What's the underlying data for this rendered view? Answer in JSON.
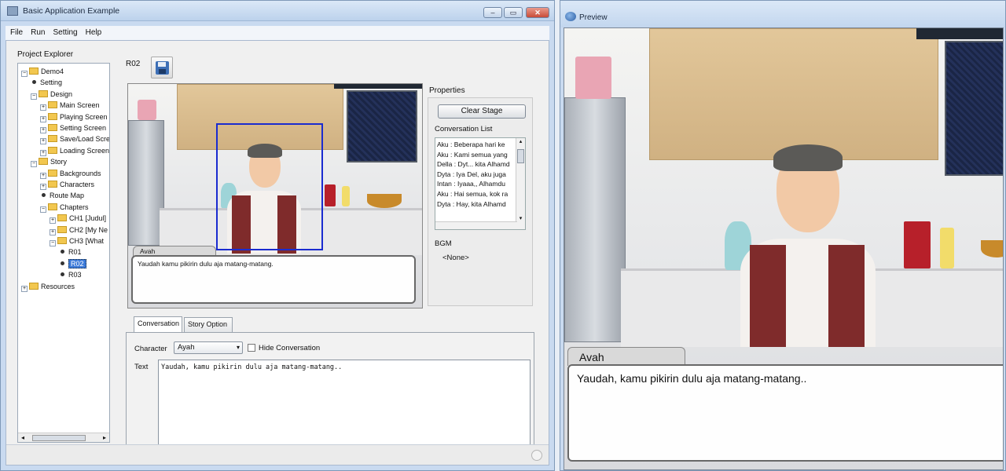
{
  "main_window": {
    "title": "Basic Application Example",
    "controls": {
      "minimize": "‒",
      "maximize": "▭",
      "close": "✕"
    },
    "menu": [
      "File",
      "Run",
      "Setting",
      "Help"
    ]
  },
  "explorer": {
    "label": "Project Explorer",
    "tree": [
      {
        "depth": 0,
        "type": "folder",
        "expander": "−",
        "label": "Demo4"
      },
      {
        "depth": 1,
        "type": "leaf",
        "label": "Setting"
      },
      {
        "depth": 1,
        "type": "folder",
        "expander": "−",
        "label": "Design"
      },
      {
        "depth": 2,
        "type": "folder",
        "expander": "+",
        "label": "Main Screen"
      },
      {
        "depth": 2,
        "type": "folder",
        "expander": "+",
        "label": "Playing Screen"
      },
      {
        "depth": 2,
        "type": "folder",
        "expander": "+",
        "label": "Setting Screen"
      },
      {
        "depth": 2,
        "type": "folder",
        "expander": "+",
        "label": "Save/Load Scre"
      },
      {
        "depth": 2,
        "type": "folder",
        "expander": "+",
        "label": "Loading Screen"
      },
      {
        "depth": 1,
        "type": "folder",
        "expander": "−",
        "label": "Story"
      },
      {
        "depth": 2,
        "type": "folder",
        "expander": "+",
        "label": "Backgrounds"
      },
      {
        "depth": 2,
        "type": "folder",
        "expander": "+",
        "label": "Characters"
      },
      {
        "depth": 2,
        "type": "leaf",
        "label": "Route Map"
      },
      {
        "depth": 2,
        "type": "folder",
        "expander": "−",
        "label": "Chapters"
      },
      {
        "depth": 3,
        "type": "folder",
        "expander": "+",
        "label": "CH1 [Judul]"
      },
      {
        "depth": 3,
        "type": "folder",
        "expander": "+",
        "label": "CH2 [My Ne"
      },
      {
        "depth": 3,
        "type": "folder",
        "expander": "−",
        "label": "CH3 [What"
      },
      {
        "depth": 4,
        "type": "leaf",
        "label": "R01"
      },
      {
        "depth": 4,
        "type": "leaf",
        "label": "R02",
        "selected": true
      },
      {
        "depth": 4,
        "type": "leaf",
        "label": "R03"
      },
      {
        "depth": 0,
        "type": "folder",
        "expander": "+",
        "label": "Resources"
      }
    ],
    "scroll_left": "◂",
    "scroll_right": "▸"
  },
  "scene": {
    "id": "R02",
    "save_icon": "floppy-disk-icon",
    "dialog_name": "Avah",
    "dialog_text": "Yaudah kamu pikirin dulu aja matang-matang."
  },
  "properties": {
    "label": "Properties",
    "clear_stage": "Clear Stage",
    "conversation_list_label": "Conversation List",
    "conversations": [
      "Aku : Beberapa hari ke",
      "Aku : Kami semua yang",
      "Della : Dyt... kita Alhamd",
      "Dyta : Iya Del, aku juga",
      "Intan : Iyaaa,, Alhamdu",
      "Aku : Hai semua, kok ra",
      "Dyta : Hay, kita Alhamd"
    ],
    "scroll_up": "▴",
    "scroll_down": "▾",
    "bgm_label": "BGM",
    "bgm_value": "<None>"
  },
  "editor": {
    "tabs": [
      "Conversation",
      "Story Option"
    ],
    "character_label": "Character",
    "character_value": "Ayah",
    "character_caret": "▾",
    "hide_conversation": "Hide Conversation",
    "text_label": "Text",
    "text_value": "Yaudah, kamu pikirin dulu aja matang-matang.."
  },
  "preview": {
    "title": "Preview",
    "dialog_name": "Avah",
    "dialog_text": "Yaudah, kamu pikirin dulu aja matang-matang.."
  },
  "colors": {
    "title_gradient_top": "#dbe8f7",
    "selection_blue": "#3d7bd9",
    "vest": "#7f2b2b",
    "cabinet": "#e2c79a"
  }
}
